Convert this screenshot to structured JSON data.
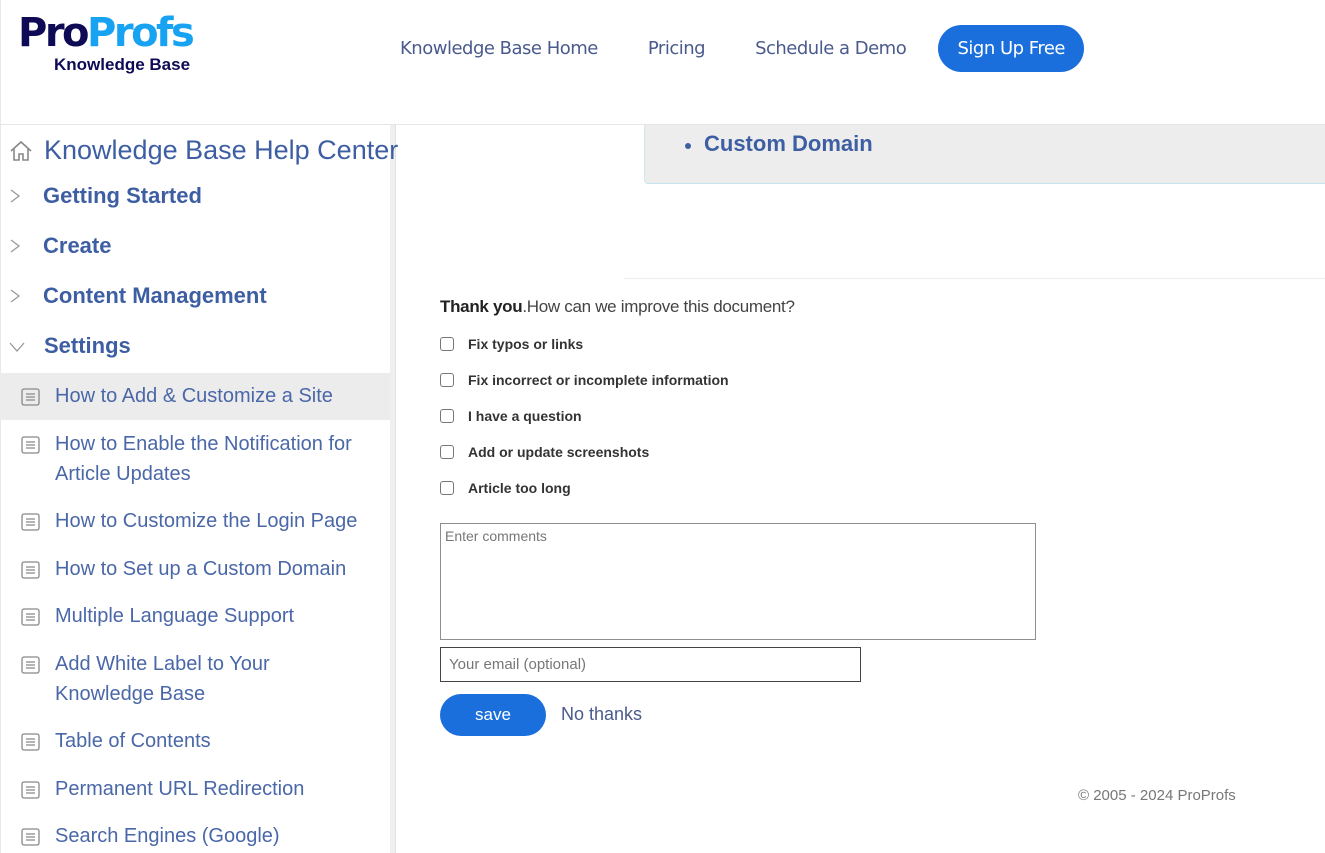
{
  "header": {
    "logo": {
      "part1": "Pro",
      "part2": "Profs",
      "subtitle": "Knowledge Base"
    },
    "nav": [
      {
        "label": "Knowledge Base Home"
      },
      {
        "label": "Pricing"
      },
      {
        "label": "Schedule a Demo"
      }
    ],
    "signup_label": "Sign Up Free"
  },
  "sidebar": {
    "home_label": "Knowledge Base Help Center",
    "categories": [
      {
        "label": "Getting Started",
        "expanded": false
      },
      {
        "label": "Create",
        "expanded": false
      },
      {
        "label": "Content Management",
        "expanded": false
      },
      {
        "label": "Settings",
        "expanded": true
      }
    ],
    "articles": [
      {
        "label": "How to Add & Customize a Site",
        "active": true
      },
      {
        "label": "How to Enable the Notification for Article Updates",
        "active": false
      },
      {
        "label": "How to Customize the Login Page",
        "active": false
      },
      {
        "label": "How to Set up a Custom Domain",
        "active": false
      },
      {
        "label": "Multiple Language Support",
        "active": false
      },
      {
        "label": "Add White Label to Your Knowledge Base",
        "active": false
      },
      {
        "label": "Table of Contents",
        "active": false
      },
      {
        "label": "Permanent URL Redirection",
        "active": false
      },
      {
        "label": "Search Engines (Google)",
        "active": false
      }
    ]
  },
  "main": {
    "callout_item": "Custom Domain",
    "feedback": {
      "title_bold": "Thank you",
      "title_rest": ".How can we improve this document?",
      "options": [
        {
          "label": "Fix typos or links",
          "checked": false
        },
        {
          "label": "Fix incorrect or incomplete information",
          "checked": false
        },
        {
          "label": "I have a question",
          "checked": false
        },
        {
          "label": "Add or update screenshots",
          "checked": false
        },
        {
          "label": "Article too long",
          "checked": false
        }
      ],
      "comments_placeholder": "Enter comments",
      "email_placeholder": "Your email (optional)",
      "save_label": "save",
      "no_thanks_label": "No thanks"
    },
    "footer": "© 2005 - 2024 ProProfs"
  },
  "colors": {
    "brand_dark": "#0f0a56",
    "brand_light": "#17a2f2",
    "primary_button": "#1a6fdc",
    "link_text": "#3e5ea3"
  }
}
